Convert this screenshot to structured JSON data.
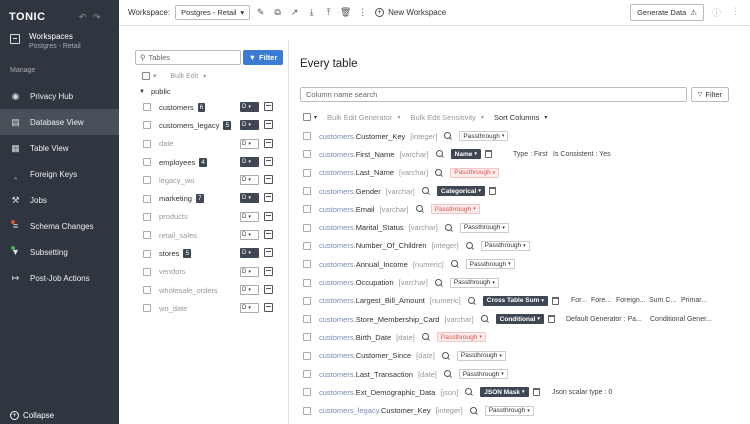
{
  "app": {
    "logo": "TONIC"
  },
  "sidebar": {
    "workspace_title": "Workspaces",
    "workspace_sub": "Postgres - Retail",
    "manage_label": "Manage",
    "items": [
      {
        "label": "Privacy Hub",
        "icon": "eye-icon"
      },
      {
        "label": "Database View",
        "icon": "database-icon",
        "active": true
      },
      {
        "label": "Table View",
        "icon": "table-icon"
      },
      {
        "label": "Foreign Keys",
        "icon": "key-icon"
      },
      {
        "label": "Jobs",
        "icon": "hammer-icon"
      },
      {
        "label": "Schema Changes",
        "icon": "schema-icon"
      },
      {
        "label": "Subsetting",
        "icon": "funnel-icon"
      },
      {
        "label": "Post-Job Actions",
        "icon": "post-job-icon"
      }
    ],
    "collapse_label": "Collapse"
  },
  "topbar": {
    "workspace_label": "Workspace:",
    "workspace_value": "Postgres - Retail",
    "new_workspace": "New Workspace",
    "generate_data": "Generate Data"
  },
  "tables_panel": {
    "search_placeholder": "Tables",
    "filter_label": "Filter",
    "bulk_edit": "Bulk Edit",
    "schema": "public",
    "tables": [
      {
        "name": "customers",
        "count": "6",
        "mode": "D",
        "muted": false,
        "dark": true
      },
      {
        "name": "customers_legacy",
        "count": "5",
        "mode": "D",
        "muted": false,
        "dark": true
      },
      {
        "name": "date",
        "count": "",
        "mode": "D",
        "muted": true,
        "dark": false
      },
      {
        "name": "employees",
        "count": "4",
        "mode": "D",
        "muted": false,
        "dark": true
      },
      {
        "name": "legacy_wo",
        "count": "",
        "mode": "D",
        "muted": true,
        "dark": false
      },
      {
        "name": "marketing",
        "count": "7",
        "mode": "D",
        "muted": false,
        "dark": true
      },
      {
        "name": "products",
        "count": "",
        "mode": "D",
        "muted": true,
        "dark": false
      },
      {
        "name": "retail_sales",
        "count": "",
        "mode": "D",
        "muted": true,
        "dark": false
      },
      {
        "name": "stores",
        "count": "5",
        "mode": "D",
        "muted": false,
        "dark": true
      },
      {
        "name": "vendors",
        "count": "",
        "mode": "D",
        "muted": true,
        "dark": false
      },
      {
        "name": "wholesale_orders",
        "count": "",
        "mode": "D",
        "muted": true,
        "dark": false
      },
      {
        "name": "wo_date",
        "count": "",
        "mode": "D",
        "muted": true,
        "dark": false
      }
    ]
  },
  "main": {
    "title": "Every table",
    "column_search_placeholder": "Column name search",
    "filter_label": "Filter",
    "bulk_edit_generator": "Bulk Edit Generator",
    "bulk_edit_sensitivity": "Bulk Edit Sensitivity",
    "sort_columns": "Sort Columns",
    "columns": [
      {
        "table": "customers.",
        "column": "Customer_Key",
        "type": "[integer]",
        "generator": "Passthrough",
        "style": "plain",
        "trash": false,
        "extra": []
      },
      {
        "table": "customers.",
        "column": "First_Name",
        "type": "[varchar]",
        "generator": "Name",
        "style": "dark",
        "trash": true,
        "extra": [
          "Type : First",
          "Is Consistent : Yes"
        ]
      },
      {
        "table": "customers.",
        "column": "Last_Name",
        "type": "[varchar]",
        "generator": "Passthrough",
        "style": "red",
        "trash": false,
        "extra": []
      },
      {
        "table": "customers.",
        "column": "Gender",
        "type": "[varchar]",
        "generator": "Categorical",
        "style": "dark",
        "trash": true,
        "extra": []
      },
      {
        "table": "customers.",
        "column": "Email",
        "type": "[varchar]",
        "generator": "Passthrough",
        "style": "red",
        "trash": false,
        "extra": []
      },
      {
        "table": "customers.",
        "column": "Marital_Status",
        "type": "[varchar]",
        "generator": "Passthrough",
        "style": "plain",
        "trash": false,
        "extra": []
      },
      {
        "table": "customers.",
        "column": "Number_Of_Children",
        "type": "[integer]",
        "generator": "Passthrough",
        "style": "plain",
        "trash": false,
        "extra": []
      },
      {
        "table": "customers.",
        "column": "Annual_Income",
        "type": "[numeric]",
        "generator": "Passthrough",
        "style": "plain",
        "trash": false,
        "extra": []
      },
      {
        "table": "customers.",
        "column": "Occupation",
        "type": "[varchar]",
        "generator": "Passthrough",
        "style": "plain",
        "trash": false,
        "extra": []
      },
      {
        "table": "customers.",
        "column": "Largest_Bill_Amount",
        "type": "[numeric]",
        "generator": "Cross Table Sum",
        "style": "dark",
        "trash": true,
        "extra": [
          "For...",
          "Fore...",
          "Foreign...",
          "Sum C...",
          "Primar..."
        ]
      },
      {
        "table": "customers.",
        "column": "Store_Membership_Card",
        "type": "[varchar]",
        "generator": "Conditional",
        "style": "dark",
        "trash": true,
        "extra": [
          "Default Generator : Pa...",
          "Conditional Gener..."
        ]
      },
      {
        "table": "customers.",
        "column": "Birth_Date",
        "type": "[date]",
        "generator": "Passthrough",
        "style": "red",
        "trash": false,
        "extra": []
      },
      {
        "table": "customers.",
        "column": "Customer_Since",
        "type": "[date]",
        "generator": "Passthrough",
        "style": "plain",
        "trash": false,
        "extra": []
      },
      {
        "table": "customers.",
        "column": "Last_Transaction",
        "type": "[date]",
        "generator": "Passthrough",
        "style": "plain",
        "trash": false,
        "extra": []
      },
      {
        "table": "customers.",
        "column": "Ext_Demographic_Data",
        "type": "[json]",
        "generator": "JSON Mask",
        "style": "dark",
        "trash": true,
        "extra": [
          "Json scalar type : 0"
        ]
      },
      {
        "table": "customers_legacy.",
        "column": "Customer_Key",
        "type": "[integer]",
        "generator": "Passthrough",
        "style": "plain",
        "trash": false,
        "extra": []
      }
    ]
  }
}
